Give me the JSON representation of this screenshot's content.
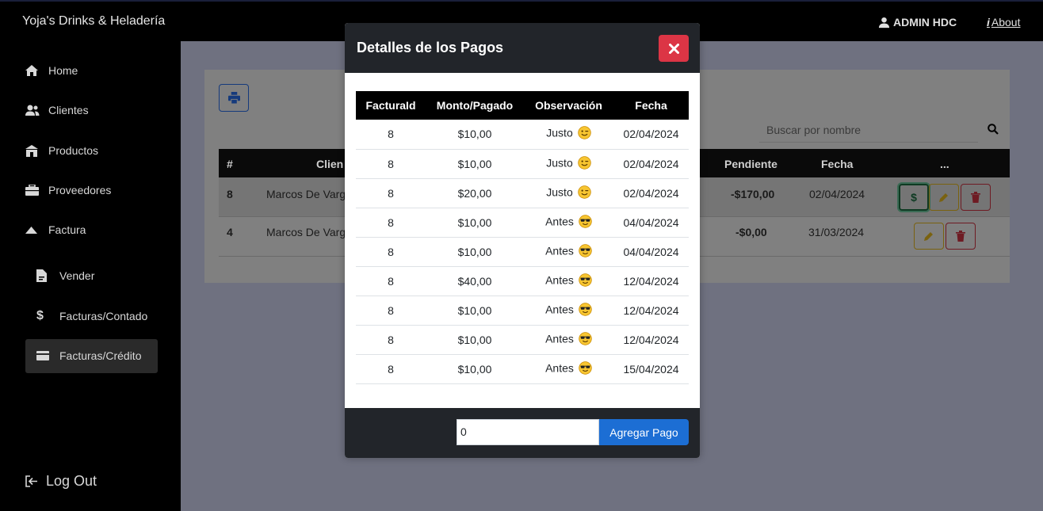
{
  "app": {
    "brand": "Yoja's Drinks & Heladería",
    "user": "ADMIN HDC",
    "about": "About"
  },
  "sidebar": {
    "items": [
      {
        "label": "Home",
        "icon": "home-icon"
      },
      {
        "label": "Clientes",
        "icon": "users-icon"
      },
      {
        "label": "Productos",
        "icon": "store-icon"
      },
      {
        "label": "Proveedores",
        "icon": "briefcase-icon"
      },
      {
        "label": "Factura",
        "icon": "caret-up-icon"
      }
    ],
    "subitems": [
      {
        "label": "Vender",
        "icon": "document-icon"
      },
      {
        "label": "Facturas/Contado",
        "icon": "dollar-icon"
      },
      {
        "label": "Facturas/Crédito",
        "icon": "credit-card-icon"
      }
    ],
    "logout": "Log Out"
  },
  "background": {
    "search_placeholder": "Buscar por nombre",
    "headers": {
      "num": "#",
      "client": "Clien",
      "pending": "Pendiente",
      "date": "Fecha",
      "actions": "..."
    },
    "rows": [
      {
        "num": "8",
        "client": "Marcos De Varg",
        "pending": "-$170,00",
        "date": "02/04/2024"
      },
      {
        "num": "4",
        "client": "Marcos De Varg",
        "pending": "-$0,00",
        "date": "31/03/2024"
      }
    ]
  },
  "modal": {
    "title": "Detalles de los Pagos",
    "columns": [
      "FacturaId",
      "Monto/Pagado",
      "Observación",
      "Fecha"
    ],
    "rows": [
      {
        "factura": "8",
        "monto": "$10,00",
        "obs": "Justo",
        "emoji": "wink",
        "fecha": "02/04/2024"
      },
      {
        "factura": "8",
        "monto": "$10,00",
        "obs": "Justo",
        "emoji": "wink",
        "fecha": "02/04/2024"
      },
      {
        "factura": "8",
        "monto": "$20,00",
        "obs": "Justo",
        "emoji": "wink",
        "fecha": "02/04/2024"
      },
      {
        "factura": "8",
        "monto": "$10,00",
        "obs": "Antes",
        "emoji": "sunglasses",
        "fecha": "04/04/2024"
      },
      {
        "factura": "8",
        "monto": "$10,00",
        "obs": "Antes",
        "emoji": "sunglasses",
        "fecha": "04/04/2024"
      },
      {
        "factura": "8",
        "monto": "$40,00",
        "obs": "Antes",
        "emoji": "sunglasses",
        "fecha": "12/04/2024"
      },
      {
        "factura": "8",
        "monto": "$10,00",
        "obs": "Antes",
        "emoji": "sunglasses",
        "fecha": "12/04/2024"
      },
      {
        "factura": "8",
        "monto": "$10,00",
        "obs": "Antes",
        "emoji": "sunglasses",
        "fecha": "12/04/2024"
      },
      {
        "factura": "8",
        "monto": "$10,00",
        "obs": "Antes",
        "emoji": "sunglasses",
        "fecha": "15/04/2024"
      }
    ],
    "payment_input_value": "0",
    "add_payment_label": "Agregar Pago"
  },
  "colors": {
    "danger": "#dc3545",
    "primary": "#1c6ed4",
    "success": "#198754",
    "warning": "#ffc107"
  }
}
